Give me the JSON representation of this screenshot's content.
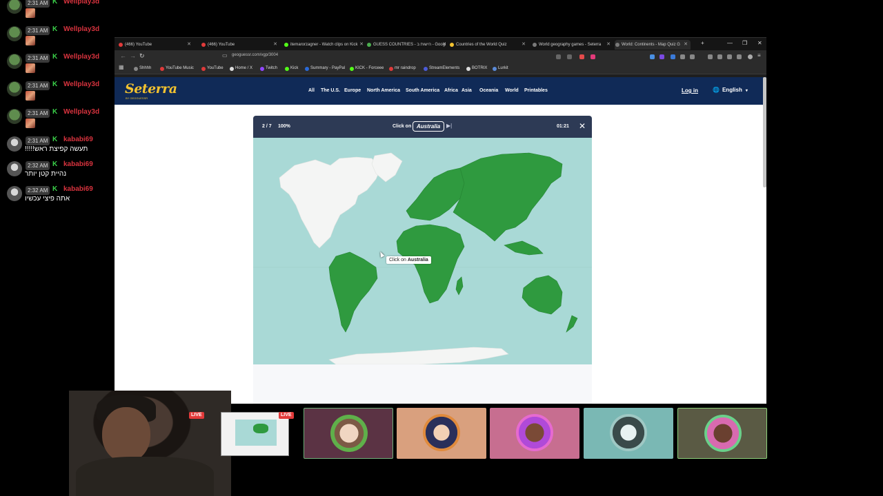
{
  "chat": [
    {
      "time": "2:31 AM",
      "user": "Wellplay3d",
      "message": "",
      "emote": true
    },
    {
      "time": "2:31 AM",
      "user": "Wellplay3d",
      "message": "",
      "emote": true
    },
    {
      "time": "2:31 AM",
      "user": "Wellplay3d",
      "message": "",
      "emote": true
    },
    {
      "time": "2:31 AM",
      "user": "Wellplay3d",
      "message": "",
      "emote": true
    },
    {
      "time": "2:31 AM",
      "user": "Wellplay3d",
      "message": "",
      "emote": true
    },
    {
      "time": "2:31 AM",
      "user": "kababi69",
      "message": "תעשה קפיצת ראש!!!!!",
      "emote": false
    },
    {
      "time": "2:32 AM",
      "user": "kababi69",
      "message": "נהיית קטן יותר",
      "emote": false
    },
    {
      "time": "2:32 AM",
      "user": "kababi69",
      "message": "אתה פיצי עכשיו",
      "emote": false
    }
  ],
  "browser": {
    "tabs": [
      {
        "label": "(466) YouTube",
        "color": "#e03a3a"
      },
      {
        "label": "(466) YouTube",
        "color": "#e03a3a"
      },
      {
        "label": "itemarorzagner - Watch clips on Kick",
        "color": "#53fc18"
      },
      {
        "label": "GUESS COUNTRIES - הישות ב - Googl",
        "color": "#4caf50"
      },
      {
        "label": "Countries of the World Quiz",
        "color": "#f2c230"
      },
      {
        "label": "World geography games - Seterra",
        "color": "#7a7a7a"
      },
      {
        "label": "World: Continents - Map Quiz G",
        "color": "#7a7a7a"
      }
    ],
    "url": "geoguessr.com/vgp/3004",
    "bookmarks": [
      {
        "label": "Shhhh",
        "color": "#888"
      },
      {
        "label": "YouTube Music",
        "color": "#e03a3a"
      },
      {
        "label": "YouTube",
        "color": "#e03a3a"
      },
      {
        "label": "Home / X",
        "color": "#ddd"
      },
      {
        "label": "Twitch",
        "color": "#9146ff"
      },
      {
        "label": "Kick",
        "color": "#53fc18"
      },
      {
        "label": "Summary - PayPal",
        "color": "#2a6ad8"
      },
      {
        "label": "KICK - Forceee",
        "color": "#53fc18"
      },
      {
        "label": "mr raindrop",
        "color": "#e03a3a"
      },
      {
        "label": "StreamElements",
        "color": "#4b5bd8"
      },
      {
        "label": "BOTRIX",
        "color": "#ddd"
      },
      {
        "label": "Lurkit",
        "color": "#5a8ad8"
      }
    ]
  },
  "site": {
    "logo": "Seterra",
    "logo_sub": "BY GEOGUESSR",
    "nav": [
      "All",
      "The U.S.",
      "Europe",
      "North America",
      "South America",
      "Africa",
      "Asia",
      "Oceania",
      "World",
      "Printables"
    ],
    "login": "Log in",
    "language": "English",
    "colors": {
      "header": "#102a57",
      "logo": "#f2c230",
      "land_answered": "#2f9a3f",
      "land_unanswered": "#f4f5f4",
      "ocean": "#a9d9d6"
    }
  },
  "quiz": {
    "progress": "2 / 7",
    "score": "100%",
    "prompt_label": "Click on",
    "target": "Australia",
    "timer": "01:21",
    "tooltip_label": "Click on",
    "tooltip_target": "Australia",
    "continents": [
      {
        "name": "North America",
        "answered": false
      },
      {
        "name": "South America",
        "answered": true
      },
      {
        "name": "Europe",
        "answered": true
      },
      {
        "name": "Africa",
        "answered": true
      },
      {
        "name": "Asia",
        "answered": true
      },
      {
        "name": "Australia",
        "answered": true
      },
      {
        "name": "Antarctica",
        "answered": false
      }
    ]
  },
  "stream": {
    "live_label": "LIVE"
  }
}
